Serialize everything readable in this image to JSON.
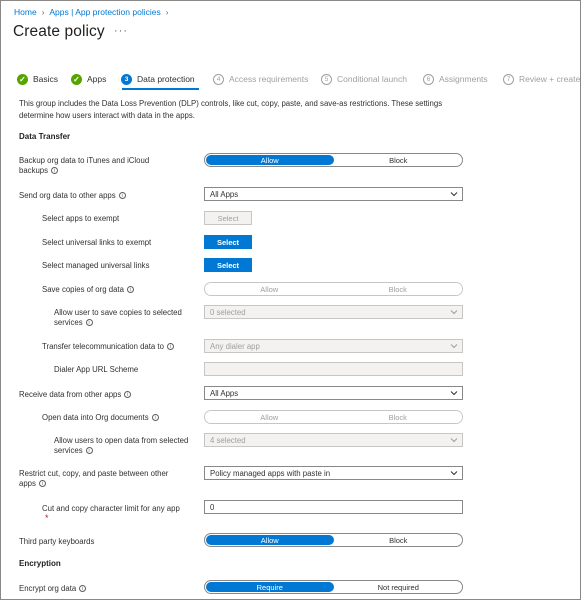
{
  "breadcrumb": {
    "home": "Home",
    "apps": "Apps | App protection policies"
  },
  "page_title": "Create policy",
  "more": "···",
  "tabs": [
    {
      "num": "✓",
      "label": "Basics"
    },
    {
      "num": "✓",
      "label": "Apps"
    },
    {
      "num": "3",
      "label": "Data protection"
    },
    {
      "num": "4",
      "label": "Access requirements"
    },
    {
      "num": "5",
      "label": "Conditional launch"
    },
    {
      "num": "6",
      "label": "Assignments"
    },
    {
      "num": "7",
      "label": "Review + create"
    }
  ],
  "intro": "This group includes the Data Loss Prevention (DLP) controls, like cut, copy, paste, and save-as restrictions. These settings determine how users interact with data in the apps.",
  "sections": {
    "transfer": "Data Transfer",
    "encryption": "Encryption"
  },
  "info_glyph": "i",
  "required_glyph": "*",
  "fields": {
    "backup": {
      "label": "Backup org data to iTunes and iCloud backups",
      "on": "Allow",
      "off": "Block"
    },
    "send": {
      "label": "Send org data to other apps",
      "value": "All Apps"
    },
    "exempt": {
      "label": "Select apps to exempt",
      "button": "Select"
    },
    "universal": {
      "label": "Select universal links to exempt",
      "button": "Select"
    },
    "managed_universal": {
      "label": "Select managed universal links",
      "button": "Select"
    },
    "save_copies": {
      "label": "Save copies of org data",
      "on": "Allow",
      "off": "Block"
    },
    "save_services": {
      "label": "Allow user to save copies to selected services",
      "value": "0 selected"
    },
    "telecom": {
      "label": "Transfer telecommunication data to",
      "value": "Any dialer app"
    },
    "dialer": {
      "label": "Dialer App URL Scheme",
      "value": ""
    },
    "receive": {
      "label": "Receive data from other apps",
      "value": "All Apps"
    },
    "open_org": {
      "label": "Open data into Org documents",
      "on": "Allow",
      "off": "Block"
    },
    "open_services": {
      "label": "Allow users to open data from selected services",
      "value": "4 selected"
    },
    "cut_copy": {
      "label": "Restrict cut, copy, and paste between other apps",
      "value": "Policy managed apps with paste in"
    },
    "char_limit": {
      "label": "Cut and copy character limit for any app",
      "value": "0"
    },
    "keyboards": {
      "label": "Third party keyboards",
      "on": "Allow",
      "off": "Block"
    },
    "encrypt": {
      "label": "Encrypt org data",
      "on": "Require",
      "off": "Not required"
    }
  },
  "colors": {
    "accent": "#0078d4",
    "done": "#57a300",
    "required": "#a4262c"
  }
}
